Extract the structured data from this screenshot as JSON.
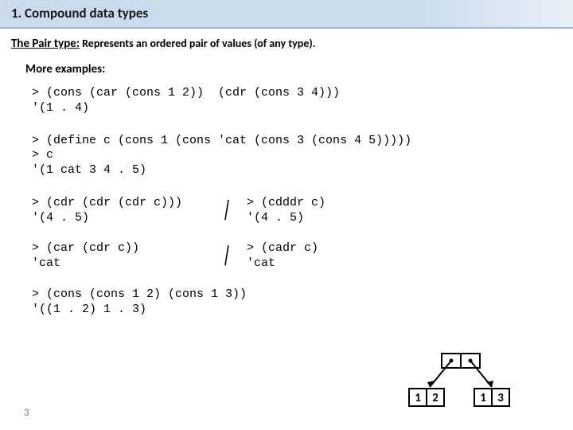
{
  "title": "1. Compound data types",
  "pair_type": {
    "lead": "The Pair type:",
    "desc": " Represents an ordered pair of values (of any type)."
  },
  "more_label": "More examples:",
  "code1": "> (cons (car (cons 1 2))  (cdr (cons 3 4)))\n'(1 . 4)",
  "code2": "> (define c (cons 1 (cons 'cat (cons 3 (cons 4 5)))))\n> c\n'(1 cat 3 4 . 5)",
  "row1": {
    "left": "> (cdr (cdr (cdr c)))\n'(4 . 5)",
    "right": "> (cdddr c)\n'(4 . 5)"
  },
  "row2": {
    "left": "> (car (cdr c))\n'cat",
    "right": "> (cadr c)\n'cat"
  },
  "code5": "> (cons (cons 1 2) (cons 1 3))\n'((1 . 2) 1 . 3)",
  "page_number": "3",
  "diagram": {
    "cell1": "1",
    "cell2": "2",
    "cell3": "1",
    "cell4": "3"
  }
}
